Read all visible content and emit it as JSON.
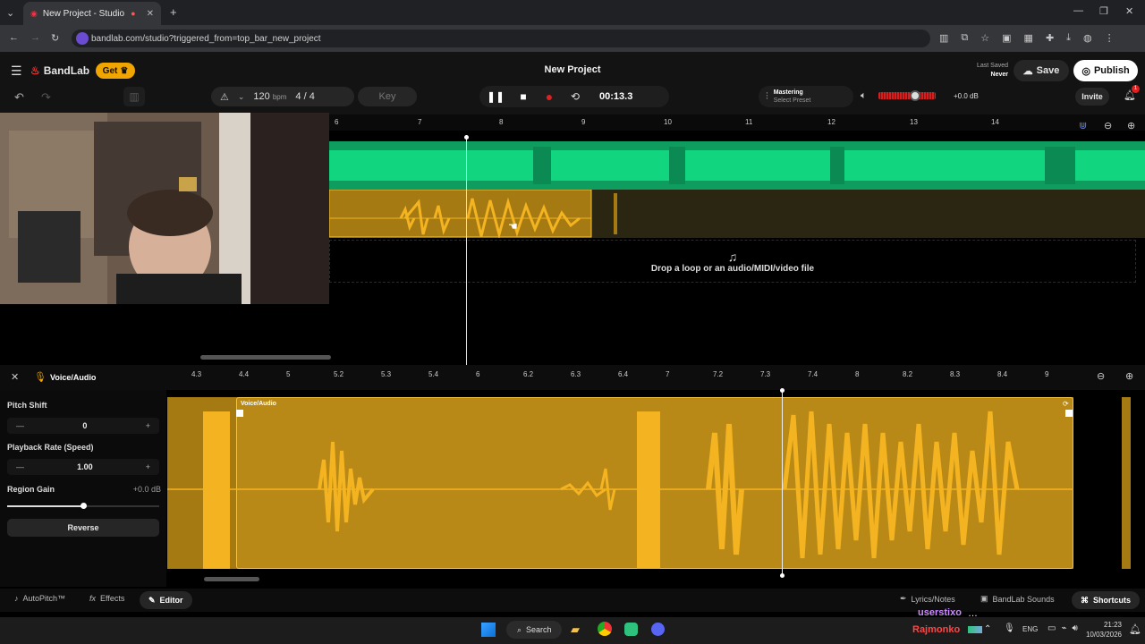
{
  "browser": {
    "tab_title": "New Project - Studio",
    "url": "bandlab.com/studio?triggered_from=top_bar_new_project"
  },
  "app": {
    "brand": "BandLab",
    "get_label": "Get",
    "project_title": "New Project",
    "last_saved_label": "Last Saved",
    "last_saved_value": "Never",
    "save_label": "Save",
    "publish_label": "Publish",
    "invite_label": "Invite",
    "notification_count": "1"
  },
  "transport": {
    "bpm_value": "120",
    "bpm_unit": "bpm",
    "time_signature": "4 / 4",
    "key_label": "Key",
    "time_display": "00:13.3",
    "mastering_label": "Mastering",
    "mastering_preset": "Select Preset",
    "volume_db": "+0.0 dB"
  },
  "ruler_top": [
    "6",
    "7",
    "8",
    "9",
    "10",
    "11",
    "12",
    "13",
    "14"
  ],
  "drop_zone_text": "Drop a loop or an audio/MIDI/video file",
  "editor": {
    "track_name": "Voice/Audio",
    "region_name": "Voice/Audio",
    "ruler": [
      "4.3",
      "4.4",
      "5",
      "5.2",
      "5.3",
      "5.4",
      "6",
      "6.2",
      "6.3",
      "6.4",
      "7",
      "7.2",
      "7.3",
      "7.4",
      "8",
      "8.2",
      "8.3",
      "8.4",
      "9"
    ],
    "pitch_shift_label": "Pitch Shift",
    "pitch_shift_value": "0",
    "playback_rate_label": "Playback Rate (Speed)",
    "playback_rate_value": "1.00",
    "region_gain_label": "Region Gain",
    "region_gain_value": "+0.0 dB",
    "reverse_label": "Reverse"
  },
  "bottom_bar": {
    "autopitch": "AutoPitch™",
    "effects": "Effects",
    "editor": "Editor",
    "lyrics": "Lyrics/Notes",
    "sounds": "BandLab Sounds",
    "shortcuts": "Shortcuts"
  },
  "taskbar": {
    "search_label": "Search",
    "lang": "ENG",
    "time": "21:23",
    "date": "10/03/2026"
  },
  "overlay": {
    "username": "userstixo",
    "name": "Rajmonko"
  },
  "colors": {
    "accent": "#f0a500",
    "green_track": "#0e9d5f",
    "yellow_track": "#f4b320",
    "record": "#e02020"
  }
}
